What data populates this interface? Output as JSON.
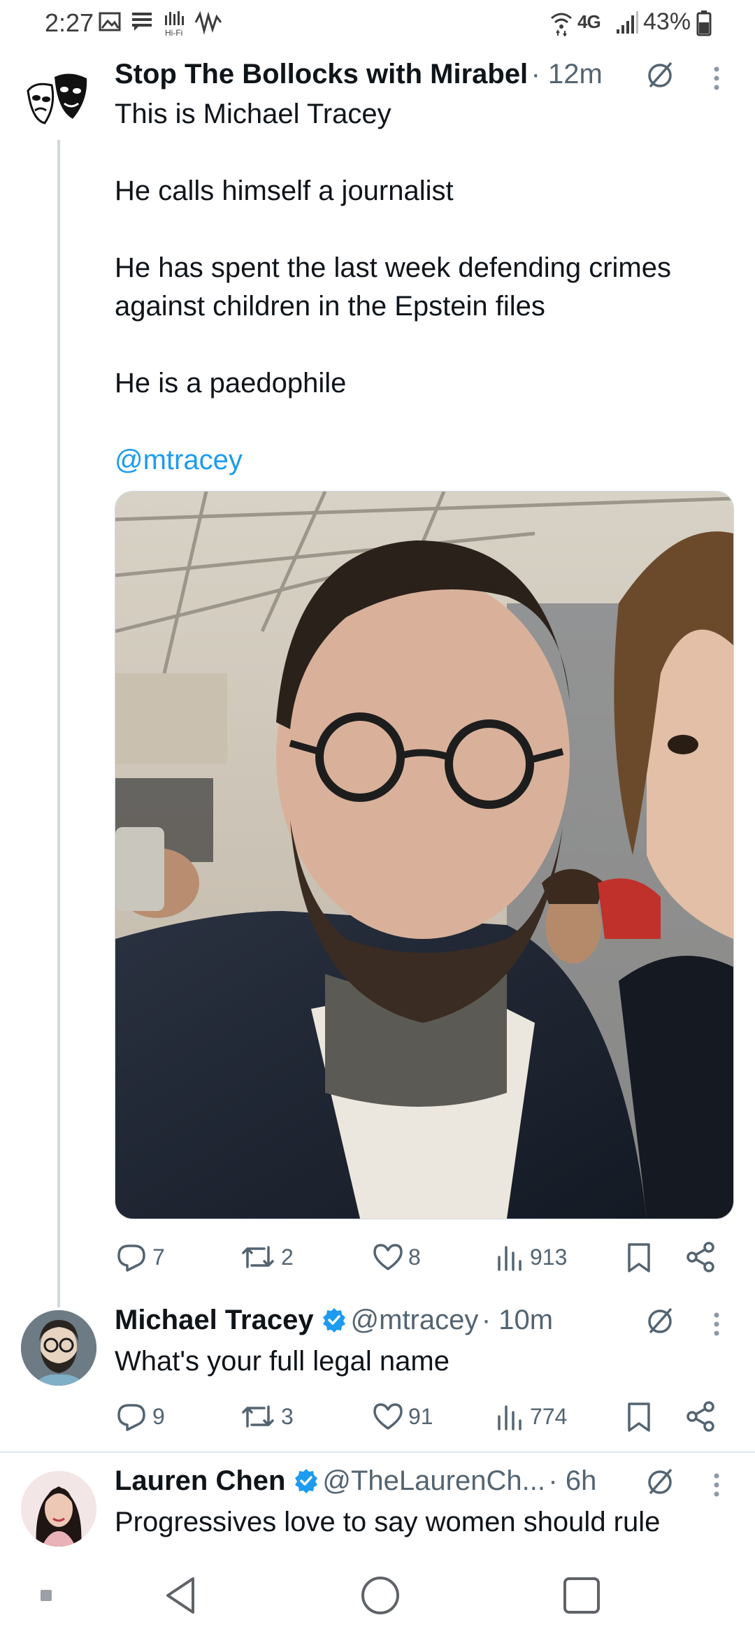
{
  "status_bar": {
    "time": "2:27",
    "hifi_label": "Hi-Fi",
    "network": "4G",
    "battery": "43%"
  },
  "tweets": [
    {
      "author": "Stop The Bollocks with Mirabel",
      "time": "· 12m",
      "text_lines": [
        "This is Michael Tracey",
        "He calls himself a journalist",
        "He has spent the last week defending crimes",
        "against children  in the Epstein files",
        "He is a paedophile"
      ],
      "mention": "@mtracey",
      "stats": {
        "replies": "7",
        "reposts": "2",
        "likes": "8",
        "views": "913"
      }
    },
    {
      "author": "Michael Tracey",
      "handle": "@mtracey",
      "time": "· 10m",
      "text": "What's your full legal name",
      "stats": {
        "replies": "9",
        "reposts": "3",
        "likes": "91",
        "views": "774"
      }
    },
    {
      "author": "Lauren Chen",
      "handle": "@TheLaurenCh...",
      "time": "· 6h",
      "text": "Progressives love to say women should rule"
    }
  ],
  "colors": {
    "accent": "#1d9bf0",
    "text": "#0f1419",
    "muted": "#536471",
    "verified": "#1d9bf0"
  },
  "icons": [
    "reply-icon",
    "repost-icon",
    "like-icon",
    "views-icon",
    "bookmark-icon",
    "share-icon",
    "more-icon",
    "grok-icon",
    "verified-badge-icon"
  ]
}
